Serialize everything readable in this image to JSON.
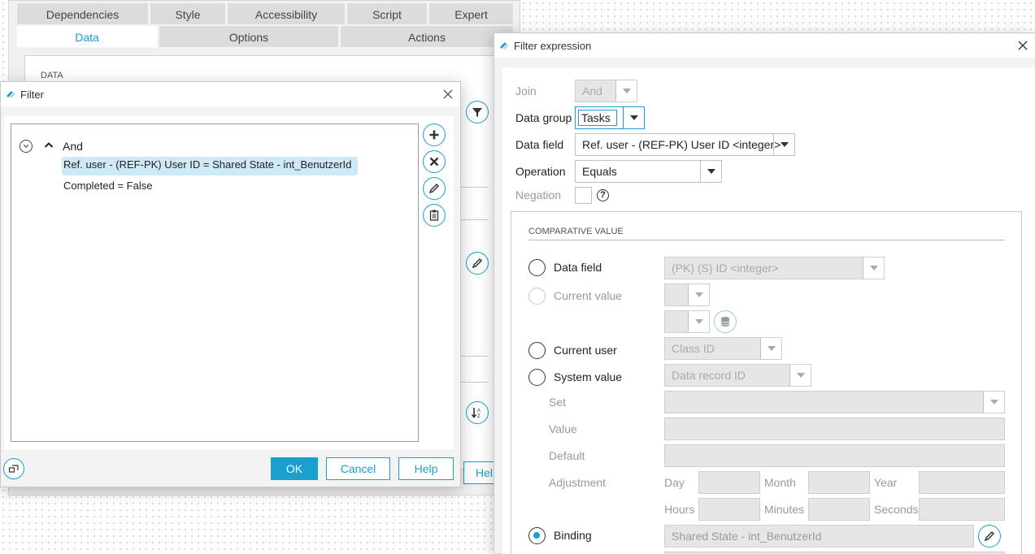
{
  "bg_window": {
    "tabs_row1": [
      "Dependencies",
      "Style",
      "Accessibility",
      "Script",
      "Expert"
    ],
    "tabs_row2": [
      "Data",
      "Options",
      "Actions"
    ],
    "section_label": "DATA",
    "help_partial": "Help"
  },
  "filter_dialog": {
    "title": "Filter",
    "root_label": "And",
    "conditions": [
      "Ref. user - (REF-PK) User ID = Shared State - int_BenutzerId",
      "Completed = False"
    ],
    "buttons": {
      "ok": "OK",
      "cancel": "Cancel",
      "help": "Help"
    }
  },
  "filter_expression": {
    "title": "Filter expression",
    "join": {
      "label": "Join",
      "value": "And"
    },
    "data_group": {
      "label": "Data group",
      "value": "Tasks"
    },
    "data_field": {
      "label": "Data field",
      "value": "Ref. user - (REF-PK) User ID <integer>"
    },
    "operation": {
      "label": "Operation",
      "value": "Equals"
    },
    "negation": {
      "label": "Negation",
      "help": "?"
    },
    "comparative": {
      "heading": "COMPARATIVE VALUE",
      "data_field": {
        "label": "Data field",
        "value": "(PK) (S) ID <integer>"
      },
      "current_value": {
        "label": "Current value"
      },
      "current_user": {
        "label": "Current user",
        "value": "Class ID"
      },
      "system_value": {
        "label": "System value",
        "value": "Data record ID"
      },
      "set_label": "Set",
      "value_label": "Value",
      "default_label": "Default",
      "adjustment_label": "Adjustment",
      "units": {
        "day": "Day",
        "month": "Month",
        "year": "Year",
        "hours": "Hours",
        "minutes": "Minutes",
        "seconds": "Seconds"
      },
      "binding": {
        "label": "Binding",
        "value": "Shared State - int_BenutzerId"
      }
    }
  },
  "colors": {
    "accent": "#1a9fd0",
    "selection": "#cdeaf6"
  }
}
